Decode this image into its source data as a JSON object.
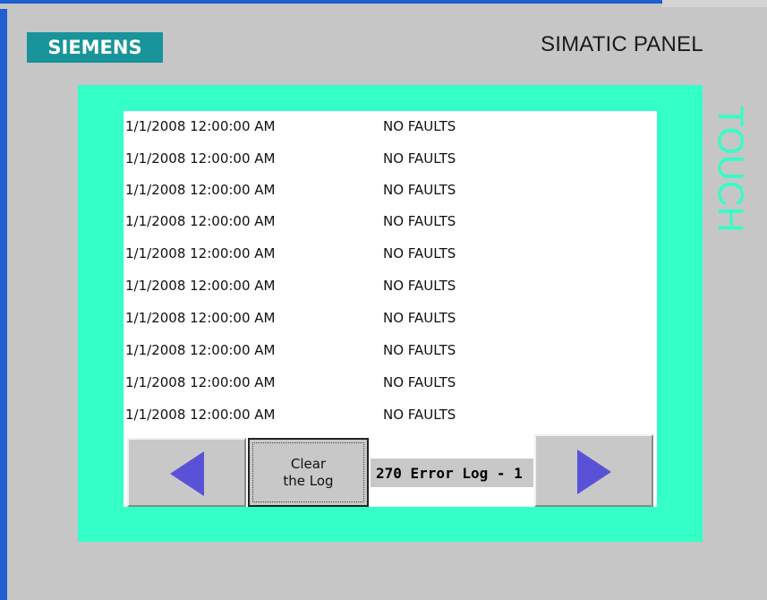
{
  "header": {
    "brand": "SIEMENS",
    "model": "SIMATIC PANEL",
    "side_label": "TOUCH"
  },
  "log": {
    "rows": [
      {
        "timestamp": "1/1/2008 12:00:00 AM",
        "status": "NO FAULTS"
      },
      {
        "timestamp": "1/1/2008 12:00:00 AM",
        "status": "NO FAULTS"
      },
      {
        "timestamp": "1/1/2008 12:00:00 AM",
        "status": "NO FAULTS"
      },
      {
        "timestamp": "1/1/2008 12:00:00 AM",
        "status": "NO FAULTS"
      },
      {
        "timestamp": "1/1/2008 12:00:00 AM",
        "status": "NO FAULTS"
      },
      {
        "timestamp": "1/1/2008 12:00:00 AM",
        "status": "NO FAULTS"
      },
      {
        "timestamp": "1/1/2008 12:00:00 AM",
        "status": "NO FAULTS"
      },
      {
        "timestamp": "1/1/2008 12:00:00 AM",
        "status": "NO FAULTS"
      },
      {
        "timestamp": "1/1/2008 12:00:00 AM",
        "status": "NO FAULTS"
      },
      {
        "timestamp": "1/1/2008 12:00:00 AM",
        "status": "NO FAULTS"
      }
    ]
  },
  "controls": {
    "clear_line1": "Clear",
    "clear_line2": "the Log",
    "page_label": "270 Error Log - 1",
    "prev_icon": "left-arrow-icon",
    "next_icon": "right-arrow-icon"
  },
  "colors": {
    "bezel": "#33ffc7",
    "brand_bg": "#18949a",
    "arrow": "#5a52d6",
    "panel": "#c6c6c6",
    "frame": "#1f5fd0"
  }
}
